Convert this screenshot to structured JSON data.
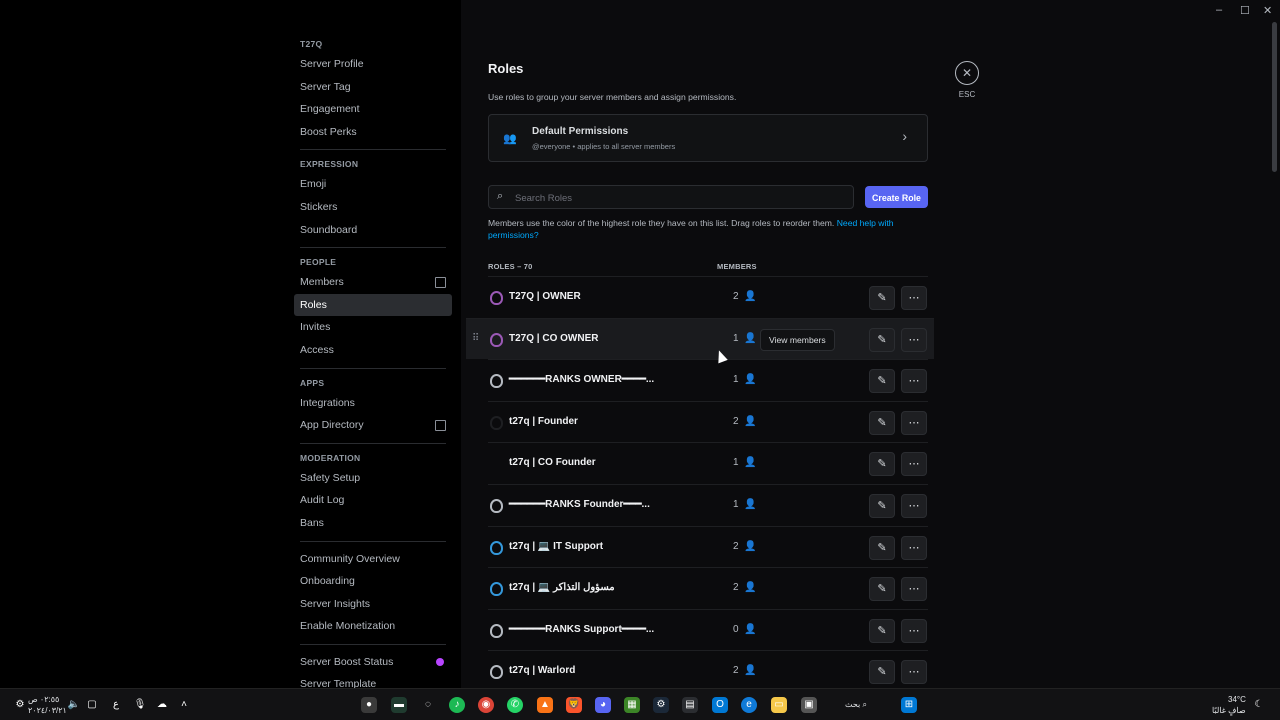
{
  "window": {
    "minimize": "–",
    "maximize": "☐",
    "close": "✕"
  },
  "sidebar": {
    "server_name": "T27Q",
    "items_top": [
      {
        "label": "Server Profile"
      },
      {
        "label": "Server Tag"
      },
      {
        "label": "Engagement"
      },
      {
        "label": "Boost Perks"
      }
    ],
    "expression_title": "EXPRESSION",
    "expression_items": [
      {
        "label": "Emoji"
      },
      {
        "label": "Stickers"
      },
      {
        "label": "Soundboard"
      }
    ],
    "people_title": "PEOPLE",
    "people_items": [
      {
        "label": "Members"
      },
      {
        "label": "Roles"
      },
      {
        "label": "Invites"
      },
      {
        "label": "Access"
      }
    ],
    "apps_title": "APPS",
    "apps_items": [
      {
        "label": "Integrations"
      },
      {
        "label": "App Directory"
      }
    ],
    "moderation_title": "MODERATION",
    "moderation_items": [
      {
        "label": "Safety Setup"
      },
      {
        "label": "Audit Log"
      },
      {
        "label": "Bans"
      }
    ],
    "community_items": [
      {
        "label": "Community Overview"
      },
      {
        "label": "Onboarding"
      },
      {
        "label": "Server Insights"
      },
      {
        "label": "Enable Monetization"
      }
    ],
    "boost_items": [
      {
        "label": "Server Boost Status"
      },
      {
        "label": "Server Template"
      }
    ]
  },
  "main": {
    "title": "Roles",
    "subtitle": "Use roles to group your server members and assign permissions.",
    "default_permissions": {
      "title": "Default Permissions",
      "subtitle": "@everyone • applies to all server members"
    },
    "search": {
      "placeholder": "Search Roles"
    },
    "create_button": "Create Role",
    "info_text": "Members use the color of the highest role they have on this list. Drag roles to reorder them.",
    "info_link": "Need help with permissions?",
    "roles_header": "ROLES – 70",
    "members_header": "MEMBERS",
    "tooltip": "View members",
    "esc_label": "ESC",
    "roles": [
      {
        "name": "T27Q | OWNER",
        "members": "2",
        "color": "#9b59b6"
      },
      {
        "name": "T27Q | CO OWNER",
        "members": "1",
        "color": "#9b59b6"
      },
      {
        "name": "━━━━━━RANKS OWNER━━━━...",
        "members": "1",
        "color": "#b5bac1"
      },
      {
        "name": "t27q | Founder",
        "members": "2",
        "color": "#1e1f22"
      },
      {
        "name": "t27q | CO Founder",
        "members": "1",
        "color": "#000000"
      },
      {
        "name": "━━━━━━RANKS Founder━━━...",
        "members": "1",
        "color": "#b5bac1"
      },
      {
        "name": "t27q | 💻 IT Support",
        "members": "2",
        "color": "#3498db"
      },
      {
        "name": "t27q | 💻 مسؤول التذاكر",
        "members": "2",
        "color": "#3498db"
      },
      {
        "name": "━━━━━━RANKS Support━━━━...",
        "members": "0",
        "color": "#b5bac1"
      },
      {
        "name": "t27q | Warlord",
        "members": "2",
        "color": "#b5bac1"
      }
    ]
  },
  "taskbar": {
    "time": "٠٢:٥٥ ص",
    "date": "٢٠٢٤/٠٣/٢١",
    "lang": "ع",
    "search": "بحث",
    "weather_temp": "34°C",
    "weather_desc": "صافٍ غالبًا"
  }
}
